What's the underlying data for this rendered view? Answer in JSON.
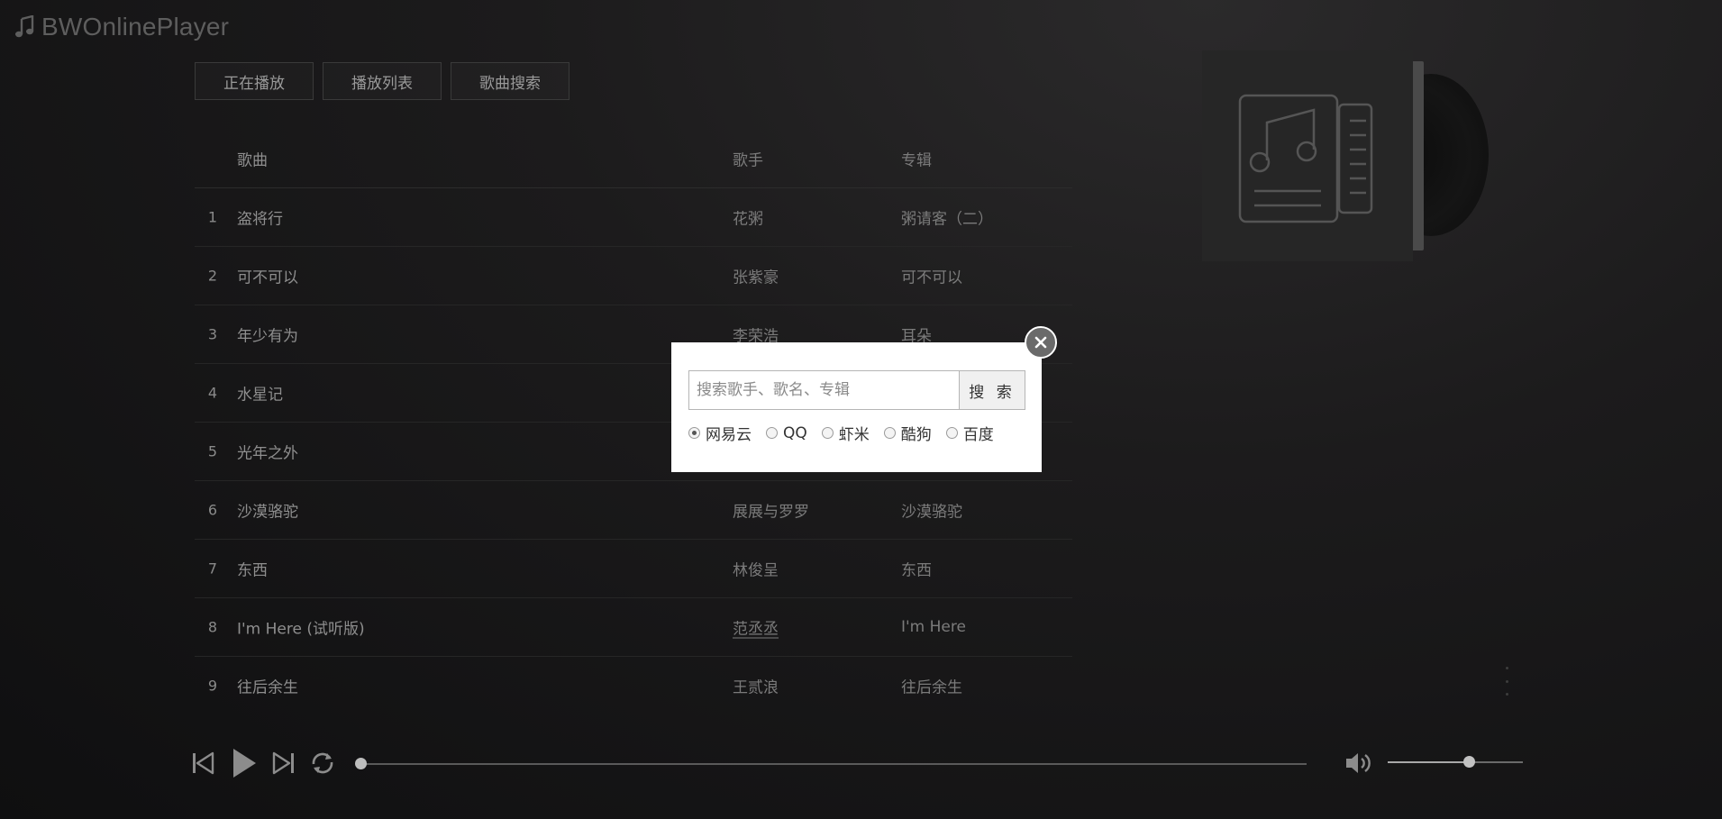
{
  "app": {
    "title": "BWOnlinePlayer"
  },
  "tabs": [
    {
      "label": "正在播放"
    },
    {
      "label": "播放列表"
    },
    {
      "label": "歌曲搜索"
    }
  ],
  "table": {
    "headers": {
      "title": "歌曲",
      "artist": "歌手",
      "album": "专辑"
    },
    "rows": [
      {
        "index": "1",
        "title": "盗将行",
        "artist": "花粥",
        "album": "粥请客（二）"
      },
      {
        "index": "2",
        "title": "可不可以",
        "artist": "张紫豪",
        "album": "可不可以"
      },
      {
        "index": "3",
        "title": "年少有为",
        "artist": "李荣浩",
        "album": "耳朵"
      },
      {
        "index": "4",
        "title": "水星记",
        "artist": "",
        "album": ""
      },
      {
        "index": "5",
        "title": "光年之外",
        "artist": "",
        "album": ""
      },
      {
        "index": "6",
        "title": "沙漠骆驼",
        "artist": "展展与罗罗",
        "album": "沙漠骆驼"
      },
      {
        "index": "7",
        "title": "东西",
        "artist": "林俊呈",
        "album": "东西"
      },
      {
        "index": "8",
        "title": "I'm Here (试听版)",
        "artist": "范丞丞",
        "album": "I'm Here"
      },
      {
        "index": "9",
        "title": "往后余生",
        "artist": "王贰浪",
        "album": "往后余生"
      }
    ]
  },
  "search_modal": {
    "placeholder": "搜索歌手、歌名、专辑",
    "button_label": "搜 索",
    "sources": [
      {
        "label": "网易云",
        "checked": true
      },
      {
        "label": "QQ",
        "checked": false
      },
      {
        "label": "虾米",
        "checked": false
      },
      {
        "label": "酷狗",
        "checked": false
      },
      {
        "label": "百度",
        "checked": false
      }
    ]
  },
  "player": {
    "progress": 0,
    "volume": 0.6
  },
  "colors": {
    "background": "#1c1b1c",
    "text": "#8a8a8a",
    "modal": "#ffffff"
  }
}
